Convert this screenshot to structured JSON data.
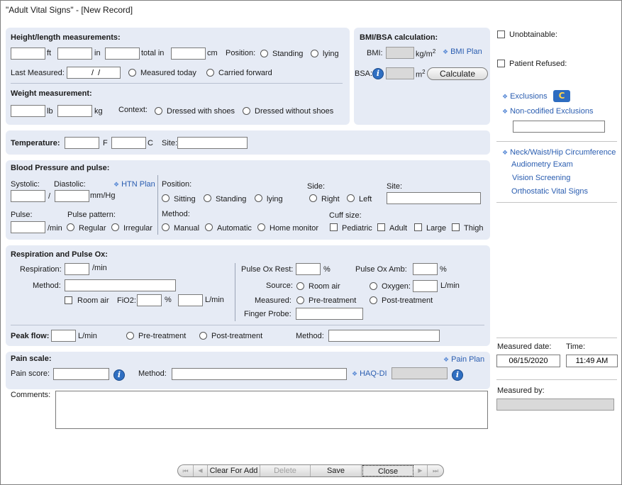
{
  "window": {
    "title": "\"Adult Vital Signs\" - [New Record]"
  },
  "height_section": {
    "heading": "Height/length measurements:",
    "ft": "ft",
    "in": "in",
    "total_in": "total in",
    "cm": "cm",
    "position_label": "Position:",
    "standing": "Standing",
    "lying": "lying",
    "last_measured_label": "Last Measured:",
    "last_measured_value": "  /  /",
    "measured_today": "Measured today",
    "carried_forward": "Carried forward"
  },
  "weight_section": {
    "heading": "Weight measurement:",
    "lb": "lb",
    "kg": "kg",
    "context_label": "Context:",
    "with_shoes": "Dressed with shoes",
    "without_shoes": "Dressed without shoes"
  },
  "bmi_section": {
    "heading": "BMI/BSA calculation:",
    "bmi_label": "BMI:",
    "bmi_unit": "kg/m",
    "bmi_sup": "2",
    "bmi_plan": "BMI Plan",
    "bsa_label": "BSA:",
    "bsa_unit": "m",
    "bsa_sup": "2",
    "calculate": "Calculate"
  },
  "temperature": {
    "label": "Temperature:",
    "f": "F",
    "c": "C",
    "site": "Site:"
  },
  "bp_section": {
    "heading": "Blood Pressure and pulse:",
    "systolic": "Systolic:",
    "diastolic": "Diastolic:",
    "slash": "/",
    "mmhg": "mm/Hg",
    "htn_plan": "HTN Plan",
    "pulse": "Pulse:",
    "per_min": "/min",
    "pulse_pattern": "Pulse pattern:",
    "regular": "Regular",
    "irregular": "Irregular",
    "position": "Position:",
    "sitting": "Sitting",
    "standing": "Standing",
    "lying": "lying",
    "side": "Side:",
    "right": "Right",
    "left": "Left",
    "site": "Site:",
    "method": "Method:",
    "manual": "Manual",
    "automatic": "Automatic",
    "home_monitor": "Home monitor",
    "cuff_size": "Cuff size:",
    "pediatric": "Pediatric",
    "adult": "Adult",
    "large": "Large",
    "thigh": "Thigh"
  },
  "resp_section": {
    "heading": "Respiration and Pulse Ox:",
    "respiration": "Respiration:",
    "per_min": "/min",
    "method": "Method:",
    "room_air": "Room air",
    "fio2": "FiO2:",
    "percent": "%",
    "lmin": "L/min",
    "pulse_ox_rest": "Pulse Ox Rest:",
    "pulse_ox_amb": "Pulse Ox Amb:",
    "source": "Source:",
    "source_room_air": "Room air",
    "oxygen": "Oxygen:",
    "measured": "Measured:",
    "pre_treatment": "Pre-treatment",
    "post_treatment": "Post-treatment",
    "finger_probe": "Finger Probe:",
    "peak_flow": "Peak flow:",
    "peak_lmin": "L/min",
    "peak_pre": "Pre-treatment",
    "peak_post": "Post-treatment",
    "peak_method": "Method:"
  },
  "pain_section": {
    "heading": "Pain scale:",
    "pain_plan": "Pain Plan",
    "pain_score": "Pain score:",
    "method": "Method:",
    "haq_di": "HAQ-DI"
  },
  "comments": {
    "label": "Comments:"
  },
  "right_panel": {
    "unobtainable": "Unobtainable:",
    "patient_refused": "Patient Refused:",
    "exclusions": "Exclusions",
    "cq_badge": "C",
    "non_codified": "Non-codified Exclusions",
    "neck_waist": "Neck/Waist/Hip Circumference",
    "audiometry": "Audiometry Exam",
    "vision": "Vision Screening",
    "orthostatic": "Orthostatic Vital Signs",
    "measured_date_label": "Measured date:",
    "measured_date": "06/15/2020",
    "time_label": "Time:",
    "time": "11:49 AM",
    "measured_by_label": "Measured by:"
  },
  "nav": {
    "clear_for_add": "Clear For Add",
    "delete": "Delete",
    "save": "Save",
    "close": "Close"
  },
  "icons": {
    "first": "⏮",
    "prev": "◀",
    "next": "▶",
    "last": "⏭"
  }
}
